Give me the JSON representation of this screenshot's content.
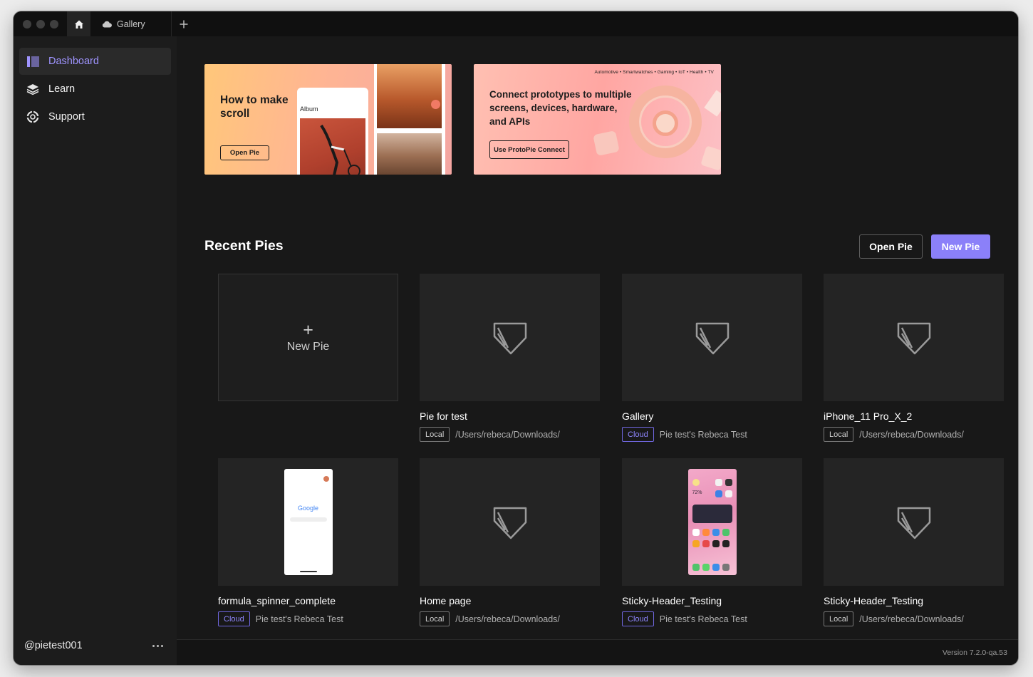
{
  "tabs": {
    "gallery_label": "Gallery"
  },
  "sidebar": {
    "items": [
      {
        "label": "Dashboard"
      },
      {
        "label": "Learn"
      },
      {
        "label": "Support"
      }
    ],
    "user_handle": "@pietest001"
  },
  "banners": {
    "scroll": {
      "title": "How to make scroll",
      "button": "Open Pie",
      "card_label": "Album"
    },
    "connect": {
      "tags": "Automotive  •  Smartwatches  •  Gaming  •  IoT  •  Health  •  TV",
      "title": "Connect prototypes to multiple screens, devices, hardware, and APIs",
      "button": "Use ProtoPie Connect"
    }
  },
  "recent": {
    "title": "Recent Pies",
    "open_button": "Open Pie",
    "new_button": "New Pie",
    "new_card_label": "New Pie",
    "pies": [
      {
        "name": "Pie for test",
        "location": "Local",
        "path": "/Users/rebeca/Downloads/"
      },
      {
        "name": "Gallery",
        "location": "Cloud",
        "path": "Pie test's Rebeca Test"
      },
      {
        "name": "iPhone_11 Pro_X_2",
        "location": "Local",
        "path": "/Users/rebeca/Downloads/"
      },
      {
        "name": "formula_spinner_complete",
        "location": "Cloud",
        "path": "Pie test's Rebeca Test"
      },
      {
        "name": "Home page",
        "location": "Local",
        "path": "/Users/rebeca/Downloads/"
      },
      {
        "name": "Sticky-Header_Testing",
        "location": "Cloud",
        "path": "Pie test's Rebeca Test"
      },
      {
        "name": "Sticky-Header_Testing",
        "location": "Local",
        "path": "/Users/rebeca/Downloads/"
      }
    ]
  },
  "google_preview_word": "Google",
  "ios_preview_percent": "72%",
  "footer": {
    "version": "Version 7.2.0-qa.53"
  },
  "colors": {
    "accent": "#8b80f9",
    "cloud_badge": "#8f86ff",
    "background": "#181818"
  }
}
